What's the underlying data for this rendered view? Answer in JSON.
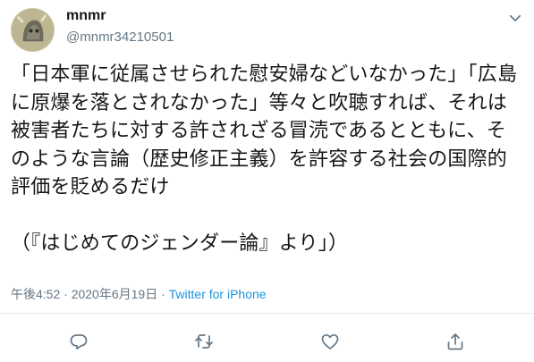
{
  "user": {
    "display_name": "mnmr",
    "handle": "@mnmr34210501"
  },
  "tweet": {
    "text": "「日本軍に従属させられた慰安婦などいなかった」「広島に原爆を落とされなかった」等々と吹聴すれば、それは被害者たちに対する許されざる冒涜であるとともに、そのような言論（歴史修正主義）を許容する社会の国際的評価を貶めるだけ\n\n（『はじめてのジェンダー論』より」）",
    "timestamp": "午後4:52 · 2020年6月19日 · ",
    "source": "Twitter for iPhone"
  },
  "icons": {
    "menu": "chevron-down-icon",
    "reply": "reply-icon",
    "retweet": "retweet-icon",
    "like": "heart-icon",
    "share": "share-icon"
  },
  "colors": {
    "text": "#14171a",
    "secondary": "#657786",
    "link": "#1b95e0",
    "divider": "#e6ecf0"
  }
}
